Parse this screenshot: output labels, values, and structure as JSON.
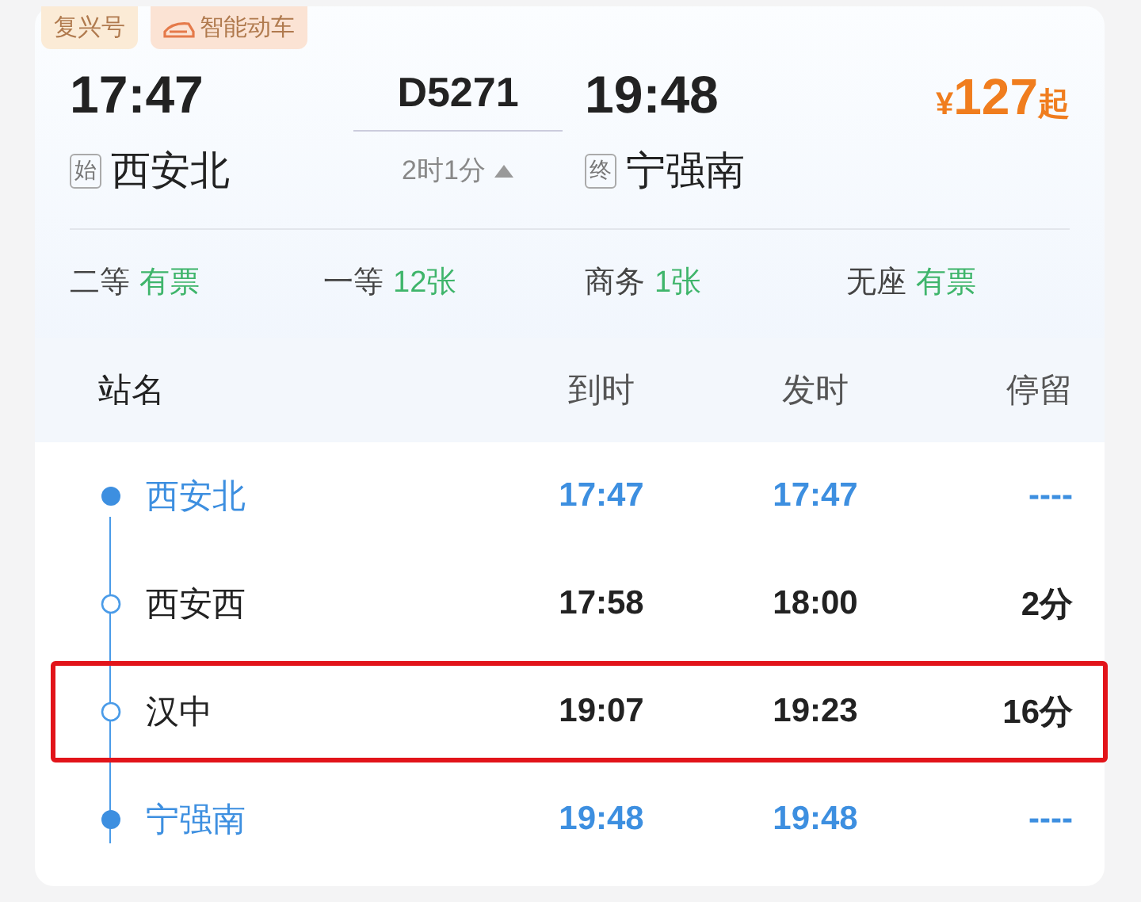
{
  "tags": [
    {
      "label": "复兴号",
      "kind": "plain"
    },
    {
      "label": "智能动车",
      "kind": "train"
    }
  ],
  "train": {
    "depart_time": "17:47",
    "number": "D5271",
    "arrive_time": "19:48",
    "price_symbol": "¥",
    "price": "127",
    "price_suffix": "起",
    "from_badge": "始",
    "from": "西安北",
    "duration": "2时1分",
    "expanded": true,
    "to_badge": "终",
    "to": "宁强南"
  },
  "seats": [
    {
      "class": "二等",
      "availability": "有票"
    },
    {
      "class": "一等",
      "availability": "12张"
    },
    {
      "class": "商务",
      "availability": "1张"
    },
    {
      "class": "无座",
      "availability": "有票"
    }
  ],
  "columns": [
    "站名",
    "到时",
    "发时",
    "停留"
  ],
  "stops": [
    {
      "station": "西安北",
      "arrive": "17:47",
      "depart": "17:47",
      "stay": "----",
      "kind": "terminal",
      "highlighted": false
    },
    {
      "station": "西安西",
      "arrive": "17:58",
      "depart": "18:00",
      "stay": "2分",
      "kind": "stop",
      "highlighted": false
    },
    {
      "station": "汉中",
      "arrive": "19:07",
      "depart": "19:23",
      "stay": "16分",
      "kind": "stop",
      "highlighted": true
    },
    {
      "station": "宁强南",
      "arrive": "19:48",
      "depart": "19:48",
      "stay": "----",
      "kind": "terminal",
      "highlighted": false
    }
  ]
}
